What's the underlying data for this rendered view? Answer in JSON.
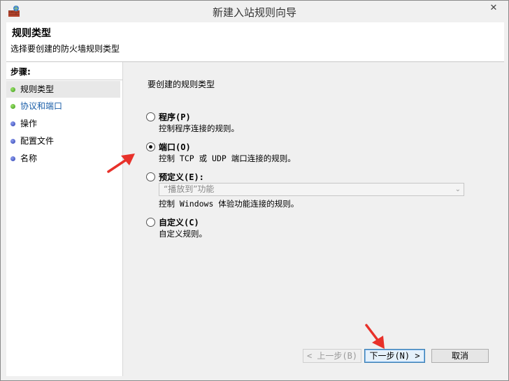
{
  "window": {
    "title": "新建入站规则向导",
    "close_glyph": "✕"
  },
  "header": {
    "title": "规则类型",
    "description": "选择要创建的防火墙规则类型"
  },
  "steps": {
    "label": "步骤:",
    "items": [
      {
        "label": "规则类型"
      },
      {
        "label": "协议和端口"
      },
      {
        "label": "操作"
      },
      {
        "label": "配置文件"
      },
      {
        "label": "名称"
      }
    ]
  },
  "main": {
    "prompt": "要创建的规则类型",
    "options": [
      {
        "title": "程序(P)",
        "description": "控制程序连接的规则。",
        "selected": false
      },
      {
        "title": "端口(O)",
        "description": "控制 TCP 或 UDP 端口连接的规则。",
        "selected": true
      },
      {
        "title": "预定义(E):",
        "select_value": "“播放到”功能",
        "description": "控制 Windows 体验功能连接的规则。",
        "selected": false
      },
      {
        "title": "自定义(C)",
        "description": "自定义规则。",
        "selected": false
      }
    ]
  },
  "buttons": {
    "back": "< 上一步(B)",
    "next": "下一步(N) >",
    "cancel": "取消"
  },
  "colors": {
    "annotation_arrow": "#e8312a",
    "link_text": "#1a5ea8"
  }
}
